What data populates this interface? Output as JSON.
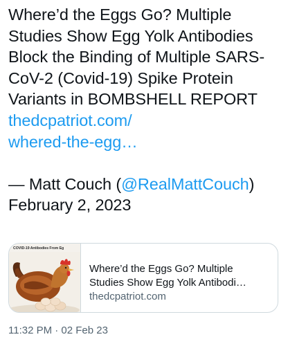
{
  "tweet": {
    "body": "Where’d the Eggs Go? Multiple Studies Show Egg Yolk Antibodies Block the Binding of Multiple SARS-CoV-2 (Covid-19) Spike Protein Variants in BOMBSHELL REPORT ",
    "link_text": "thedcpatriot.com/\nwhered-the-egg…",
    "attribution_prefix": "— Matt Couch (",
    "handle": "@RealMattCouch",
    "attribution_suffix": ")",
    "date": "February 2, 2023"
  },
  "card": {
    "thumbnail_caption": "COVID-19 Antibodies From Eg",
    "title": "Where’d the Eggs Go? Multiple Studies Show Egg Yolk Antibodi…",
    "domain": "thedcpatriot.com"
  },
  "meta": {
    "timestamp": "11:32 PM · 02 Feb 23"
  },
  "colors": {
    "link": "#1d9bf0",
    "text": "#0f1419",
    "secondary": "#536471",
    "border": "#cfd9de"
  }
}
